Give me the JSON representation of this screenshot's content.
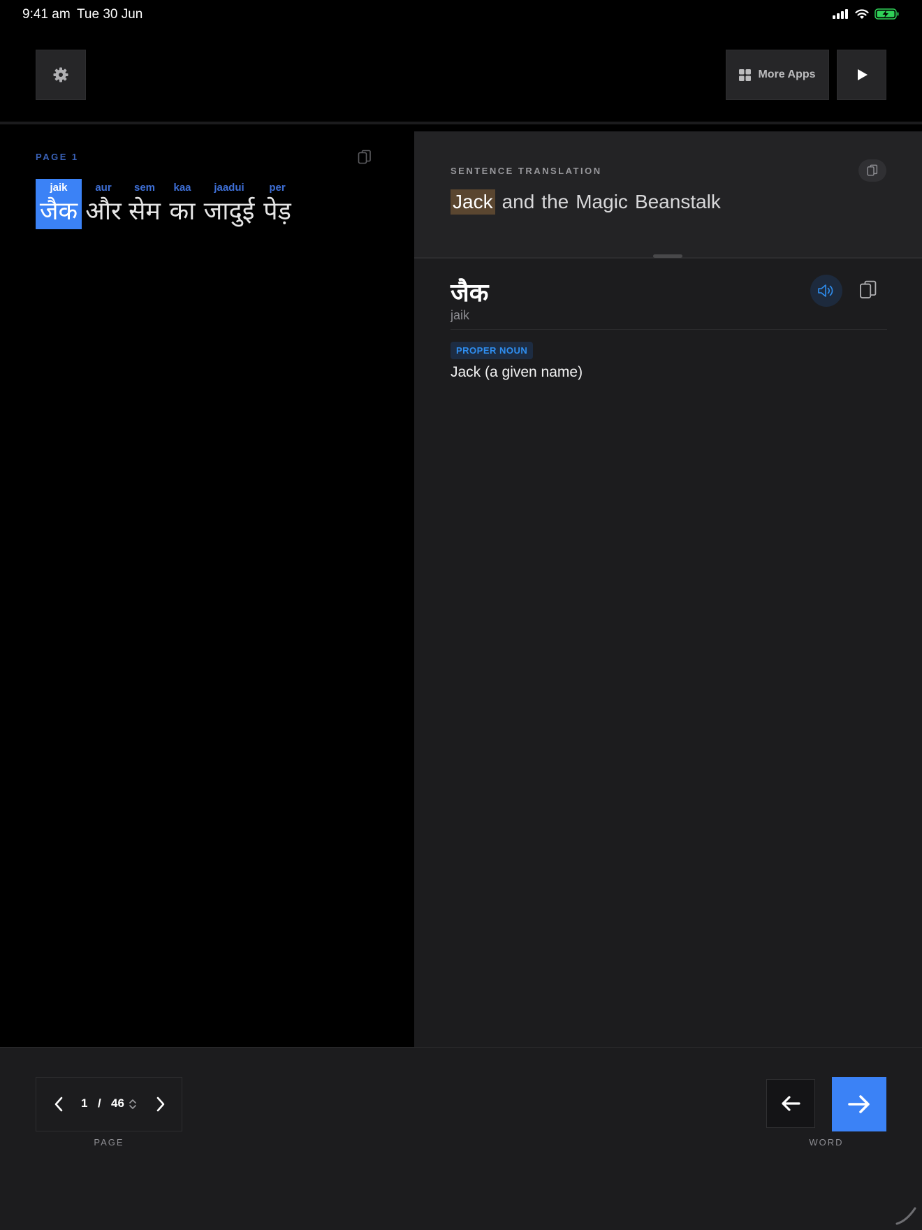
{
  "status_bar": {
    "time": "9:41 am",
    "date": "Tue 30 Jun"
  },
  "toolbar": {
    "settings_icon": "gear-icon",
    "more_apps_label": "More Apps",
    "more_apps_icon": "grid-icon",
    "play_icon": "play-icon"
  },
  "reader": {
    "page_label": "PAGE",
    "page_number": "1",
    "words": [
      {
        "translit": "jaik",
        "hindi": "जैक",
        "selected": true
      },
      {
        "translit": "aur",
        "hindi": "और",
        "selected": false
      },
      {
        "translit": "sem",
        "hindi": "सेम",
        "selected": false
      },
      {
        "translit": "kaa",
        "hindi": "का",
        "selected": false
      },
      {
        "translit": "jaadui",
        "hindi": "जादुई",
        "selected": false
      },
      {
        "translit": "per",
        "hindi": "पेड़",
        "selected": false
      }
    ]
  },
  "translation": {
    "title": "SENTENCE TRANSLATION",
    "highlighted": "Jack",
    "words": [
      "and",
      "the",
      "Magic",
      "Beanstalk"
    ]
  },
  "definition": {
    "headword": "जैक",
    "translit": "jaik",
    "part_of_speech": "PROPER NOUN",
    "meaning": "Jack (a given name)"
  },
  "pager": {
    "current": "1",
    "separator": "/",
    "total": "46",
    "caption": "PAGE"
  },
  "word_nav": {
    "caption": "WORD"
  },
  "colors": {
    "accent": "#3b82f6",
    "highlight": "#5a4630",
    "badge_text": "#2f8ef0"
  }
}
